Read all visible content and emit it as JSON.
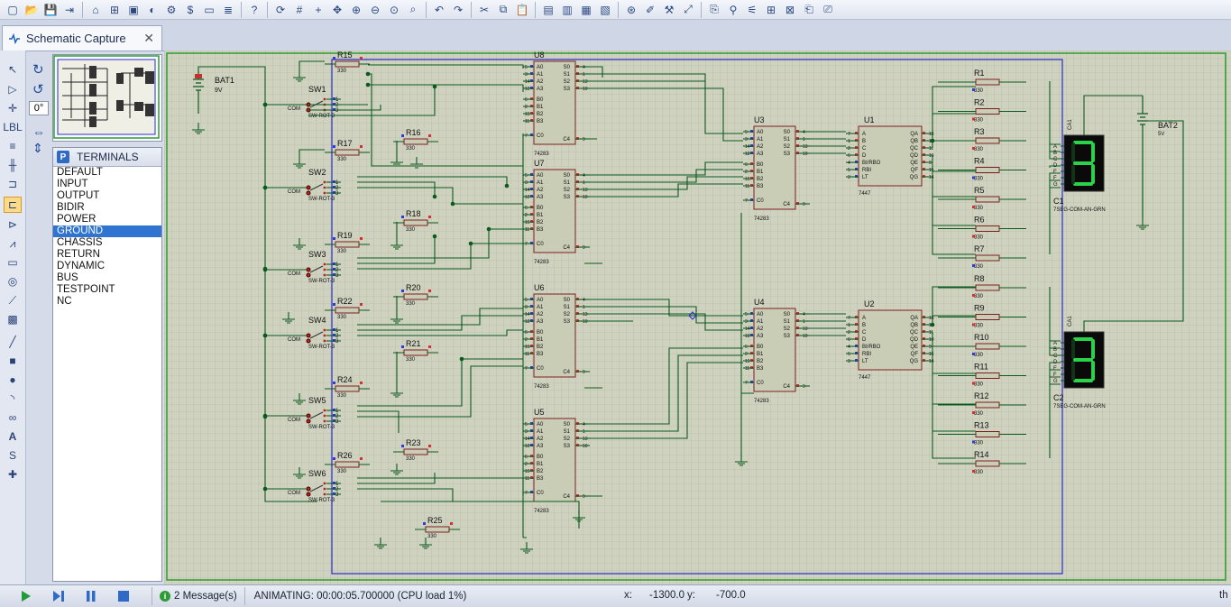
{
  "tab": {
    "label": "Schematic Capture",
    "close": "✕"
  },
  "rotation": {
    "angle": "0°"
  },
  "terminals": {
    "badge": "P",
    "title": "TERMINALS",
    "items": [
      "DEFAULT",
      "INPUT",
      "OUTPUT",
      "BIDIR",
      "POWER",
      "GROUND",
      "CHASSIS",
      "RETURN",
      "DYNAMIC",
      "BUS",
      "TESTPOINT",
      "NC"
    ],
    "selected": "GROUND"
  },
  "schematic": {
    "battery1": {
      "name": "BAT1",
      "value": "9V"
    },
    "battery2": {
      "name": "BAT2",
      "value": "5V"
    },
    "switches": [
      {
        "name": "SW1",
        "common": "COM",
        "type": "SW-ROT-3",
        "pins": [
          "1",
          "2",
          "3"
        ]
      },
      {
        "name": "SW2",
        "common": "COM",
        "type": "SW-ROT-3",
        "pins": [
          "1",
          "2",
          "3"
        ]
      },
      {
        "name": "SW3",
        "common": "COM",
        "type": "SW-ROT-3",
        "pins": [
          "1",
          "2",
          "3"
        ]
      },
      {
        "name": "SW4",
        "common": "COM",
        "type": "SW-ROT-3",
        "pins": [
          "1",
          "2",
          "3"
        ]
      },
      {
        "name": "SW5",
        "common": "COM",
        "type": "SW-ROT-3",
        "pins": [
          "1",
          "2",
          "3"
        ]
      },
      {
        "name": "SW6",
        "common": "COM",
        "type": "SW-ROT-3",
        "pins": [
          "1",
          "2",
          "3"
        ]
      }
    ],
    "left_resistors": [
      {
        "name": "R15",
        "value": "330"
      },
      {
        "name": "R16",
        "value": "330"
      },
      {
        "name": "R17",
        "value": "330"
      },
      {
        "name": "R18",
        "value": "330"
      },
      {
        "name": "R19",
        "value": "330"
      },
      {
        "name": "R20",
        "value": "330"
      },
      {
        "name": "R22",
        "value": "330"
      },
      {
        "name": "R21",
        "value": "330"
      },
      {
        "name": "R24",
        "value": "330"
      },
      {
        "name": "R23",
        "value": "330"
      },
      {
        "name": "R26",
        "value": "330"
      },
      {
        "name": "R25",
        "value": "330"
      }
    ],
    "adders": [
      {
        "name": "U8",
        "part": "74283"
      },
      {
        "name": "U7",
        "part": "74283"
      },
      {
        "name": "U6",
        "part": "74283"
      },
      {
        "name": "U5",
        "part": "74283"
      },
      {
        "name": "U3",
        "part": "74283"
      },
      {
        "name": "U4",
        "part": "74283"
      }
    ],
    "adder_pins": {
      "inputs": [
        "A0",
        "A1",
        "A2",
        "A3",
        "B0",
        "B1",
        "B2",
        "B3",
        "C0"
      ],
      "outputs": [
        "S0",
        "S1",
        "S2",
        "S3",
        "C4"
      ],
      "in_nums": [
        "5",
        "3",
        "14",
        "12",
        "6",
        "2",
        "15",
        "11",
        "7"
      ],
      "out_nums": [
        "4",
        "1",
        "13",
        "10",
        "9"
      ]
    },
    "decoders": [
      {
        "name": "U1",
        "part": "7447"
      },
      {
        "name": "U2",
        "part": "7447"
      }
    ],
    "decoder_pins": {
      "inputs": [
        "A",
        "B",
        "C",
        "D",
        "BI/RBO",
        "RBI",
        "LT"
      ],
      "outputs": [
        "QA",
        "QB",
        "QC",
        "QD",
        "QE",
        "QF",
        "QG"
      ],
      "in_nums": [
        "7",
        "1",
        "2",
        "6",
        "4",
        "5",
        "3"
      ],
      "out_nums": [
        "13",
        "12",
        "11",
        "10",
        "9",
        "15",
        "14"
      ]
    },
    "right_resistors": [
      {
        "name": "R1",
        "value": "330"
      },
      {
        "name": "R2",
        "value": "330"
      },
      {
        "name": "R3",
        "value": "330"
      },
      {
        "name": "R4",
        "value": "330"
      },
      {
        "name": "R5",
        "value": "330"
      },
      {
        "name": "R6",
        "value": "330"
      },
      {
        "name": "R7",
        "value": "330"
      },
      {
        "name": "R8",
        "value": "330"
      },
      {
        "name": "R9",
        "value": "330"
      },
      {
        "name": "R10",
        "value": "330"
      },
      {
        "name": "R11",
        "value": "330"
      },
      {
        "name": "R12",
        "value": "330"
      },
      {
        "name": "R13",
        "value": "330"
      },
      {
        "name": "R14",
        "value": "330"
      }
    ],
    "displays": [
      {
        "name": "C1",
        "part": "7SEG-COM-AN-GRN",
        "digit": "3",
        "anode": "CA1",
        "segments": [
          "A",
          "B",
          "C",
          "D",
          "E",
          "F",
          "G"
        ]
      },
      {
        "name": "C2",
        "part": "7SEG-COM-AN-GRN",
        "digit": "3",
        "anode": "CA1",
        "segments": [
          "A",
          "B",
          "C",
          "D",
          "E",
          "F",
          "G"
        ]
      }
    ]
  },
  "status": {
    "messages": "2 Message(s)",
    "animating": "ANIMATING: 00:00:05.700000 (CPU load 1%)",
    "x_label": "x:",
    "x_value": "-1300.0",
    "y_label": "y:",
    "y_value": "-700.0",
    "units": "th"
  },
  "colors": {
    "wire": "#0a5a1e",
    "part_fill": "#c9cdb5",
    "part_border": "#7b1e1e",
    "frame": "#2a2acb",
    "seg_on": "#2ad34a",
    "seg_bg": "#0a0a0a",
    "pin_blue": "#2f3bd6",
    "pin_red": "#d62f2f"
  }
}
